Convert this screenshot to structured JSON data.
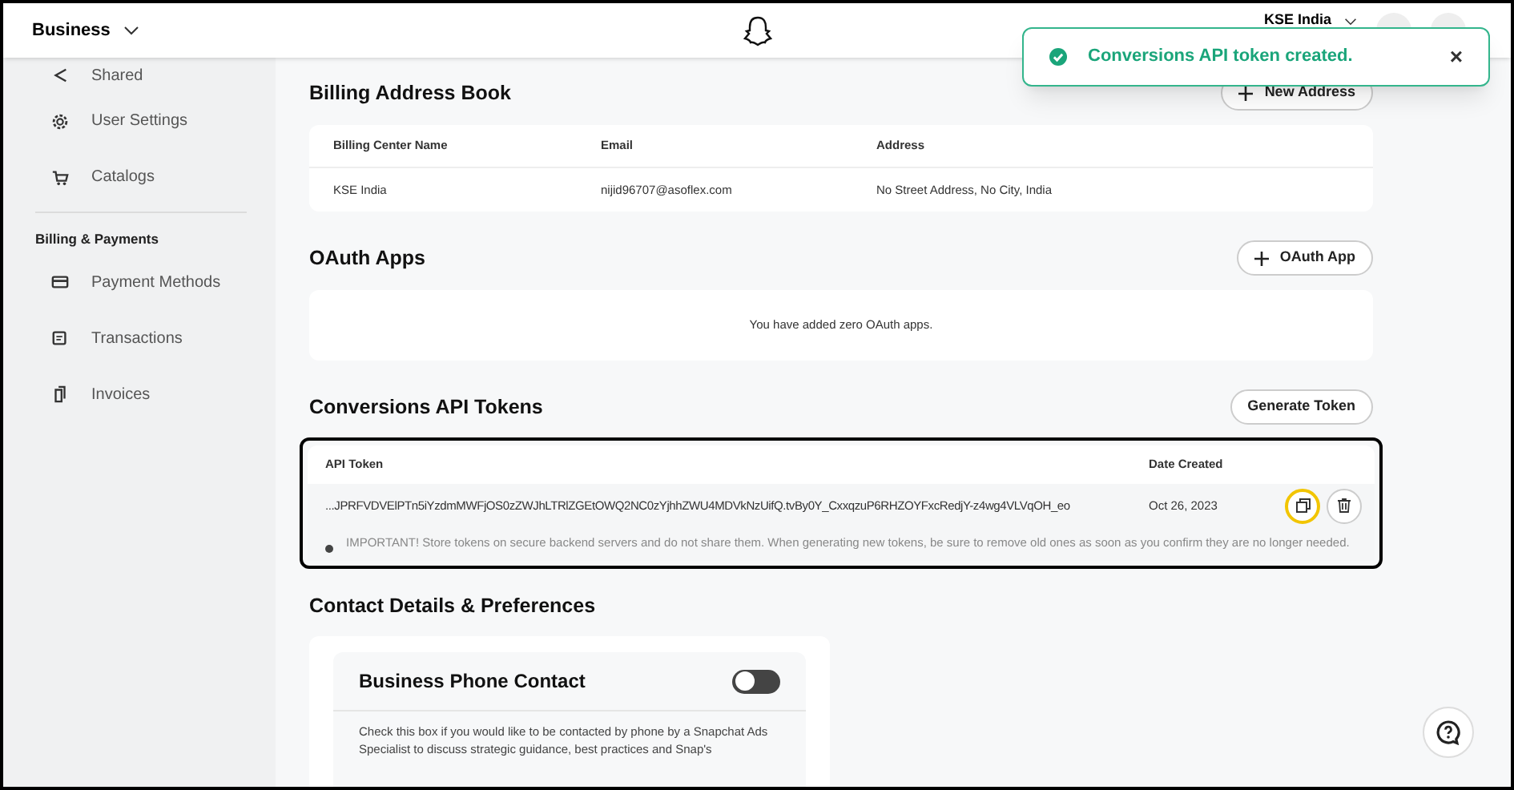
{
  "header": {
    "workspace": "Business",
    "account": "KSE India"
  },
  "toast": {
    "message": "Conversions API token created.",
    "close": "×"
  },
  "sidebar": {
    "items": [
      {
        "kind": "link",
        "label": "Shared"
      },
      {
        "kind": "link",
        "label": "User Settings"
      },
      {
        "kind": "link",
        "label": "Catalogs"
      },
      {
        "kind": "heading",
        "label": "Billing & Payments"
      },
      {
        "kind": "link",
        "label": "Payment Methods"
      },
      {
        "kind": "link",
        "label": "Transactions"
      },
      {
        "kind": "link",
        "label": "Invoices"
      }
    ]
  },
  "billing": {
    "title": "Billing Address Book",
    "button": "New Address",
    "columns": [
      "Billing Center Name",
      "Email",
      "Address"
    ],
    "rows": [
      [
        "KSE India",
        "nijid96707@asoflex.com",
        "No Street Address, No City, India"
      ]
    ]
  },
  "oauth": {
    "title": "OAuth Apps",
    "button": "OAuth App",
    "empty": "You have added zero OAuth apps."
  },
  "tokens": {
    "title": "Conversions API Tokens",
    "button": "Generate Token",
    "columns": [
      "API Token",
      "Date Created"
    ],
    "rows": [
      {
        "token": "...JPRFVDVElPTn5iYzdmMWFjOS0zZWJhLTRlZGEtOWQ2NC0zYjhhZWU4MDVkNzUifQ.tvBy0Y_CxxqzuP6RHZOYFxcRedjY-z4wg4VLVqOH_eo",
        "date": "Oct 26, 2023",
        "copy_focused": true
      }
    ],
    "note": "IMPORTANT! Store tokens on secure backend servers and do not share them. When generating new tokens, be sure to remove old ones as soon as you confirm they are no longer needed."
  },
  "contact": {
    "title": "Contact Details & Preferences",
    "card_title": "Business Phone Contact",
    "on": false,
    "text": "Check this box if you would like to be contacted by phone by a Snapchat Ads Specialist to discuss strategic guidance, best practices and Snap's"
  }
}
